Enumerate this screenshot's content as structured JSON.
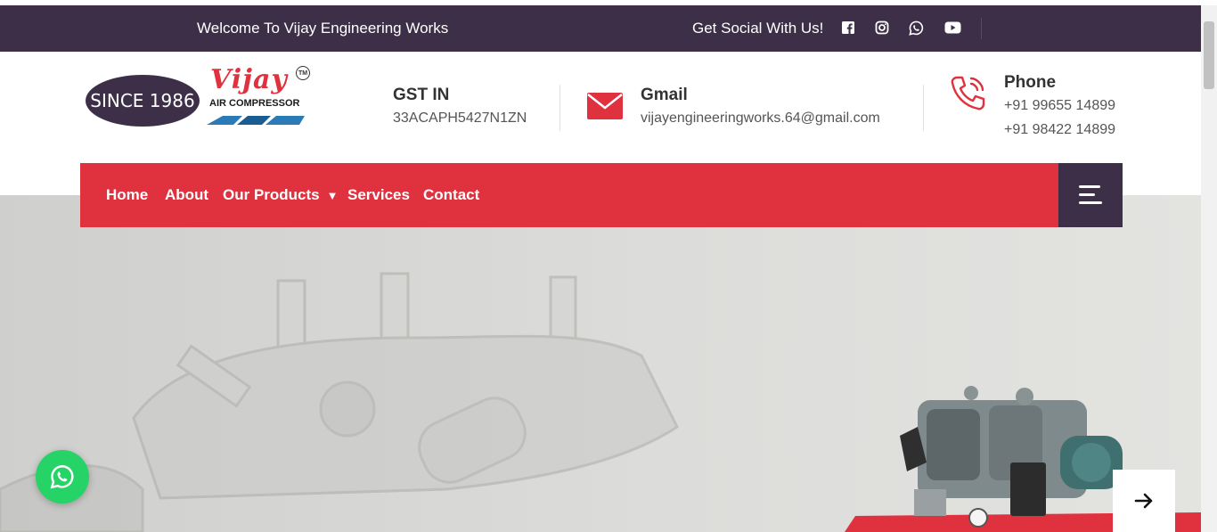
{
  "topbar": {
    "welcome": "Welcome To Vijay Engineering Works",
    "social_label": "Get Social With Us!",
    "social_icons": [
      "facebook-icon",
      "instagram-icon",
      "whatsapp-icon",
      "youtube-icon"
    ],
    "background": "#3c2f47"
  },
  "logo": {
    "since": "SINCE 1986",
    "brand": "Vijay",
    "tm": "TM",
    "tagline": "AIR COMPRESSOR"
  },
  "gst": {
    "title": "GST IN",
    "value": "33ACAPH5427N1ZN"
  },
  "gmail": {
    "title": "Gmail",
    "value": "vijayengineeringworks.64@gmail.com",
    "icon": "mail-icon"
  },
  "phone": {
    "title": "Phone",
    "numbers": [
      "+91 99655 14899",
      "+91 98422 14899"
    ],
    "icon": "phone-icon"
  },
  "nav": {
    "items": [
      "Home",
      "About",
      "Our Products",
      "Services",
      "Contact"
    ],
    "menu_icon": "menu-icon",
    "background": "#e0313f"
  },
  "colors": {
    "accent": "#e0313f",
    "dark": "#3c2f47",
    "whatsapp": "#25d366"
  }
}
